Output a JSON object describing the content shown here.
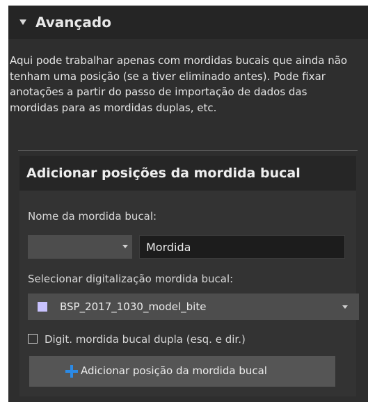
{
  "section": {
    "title": "Avançado",
    "description": "Aqui pode trabalhar apenas com mordidas bucais que ainda não tenham uma posição (se a tiver eliminado antes). Pode fixar anotações a partir do passo de importação de dados das mordidas para as mordidas duplas, etc."
  },
  "subsection": {
    "title": "Adicionar posições da mordida bucal",
    "name_label": "Nome da mordida bucal:",
    "name_prefix_value": "",
    "name_value": "Mordida",
    "scan_label": "Selecionar digitalização mordida bucal:",
    "scan_value": "BSP_2017_1030_model_bite",
    "scan_swatch_color": "#c9c3ff",
    "double_bite_label": "Digit. mordida bucal dupla (esq. e dir.)",
    "double_bite_checked": false,
    "add_button_label": "Adicionar posição da mordida bucal",
    "add_icon": "plus-icon",
    "accent_color": "#2b8ae6"
  }
}
